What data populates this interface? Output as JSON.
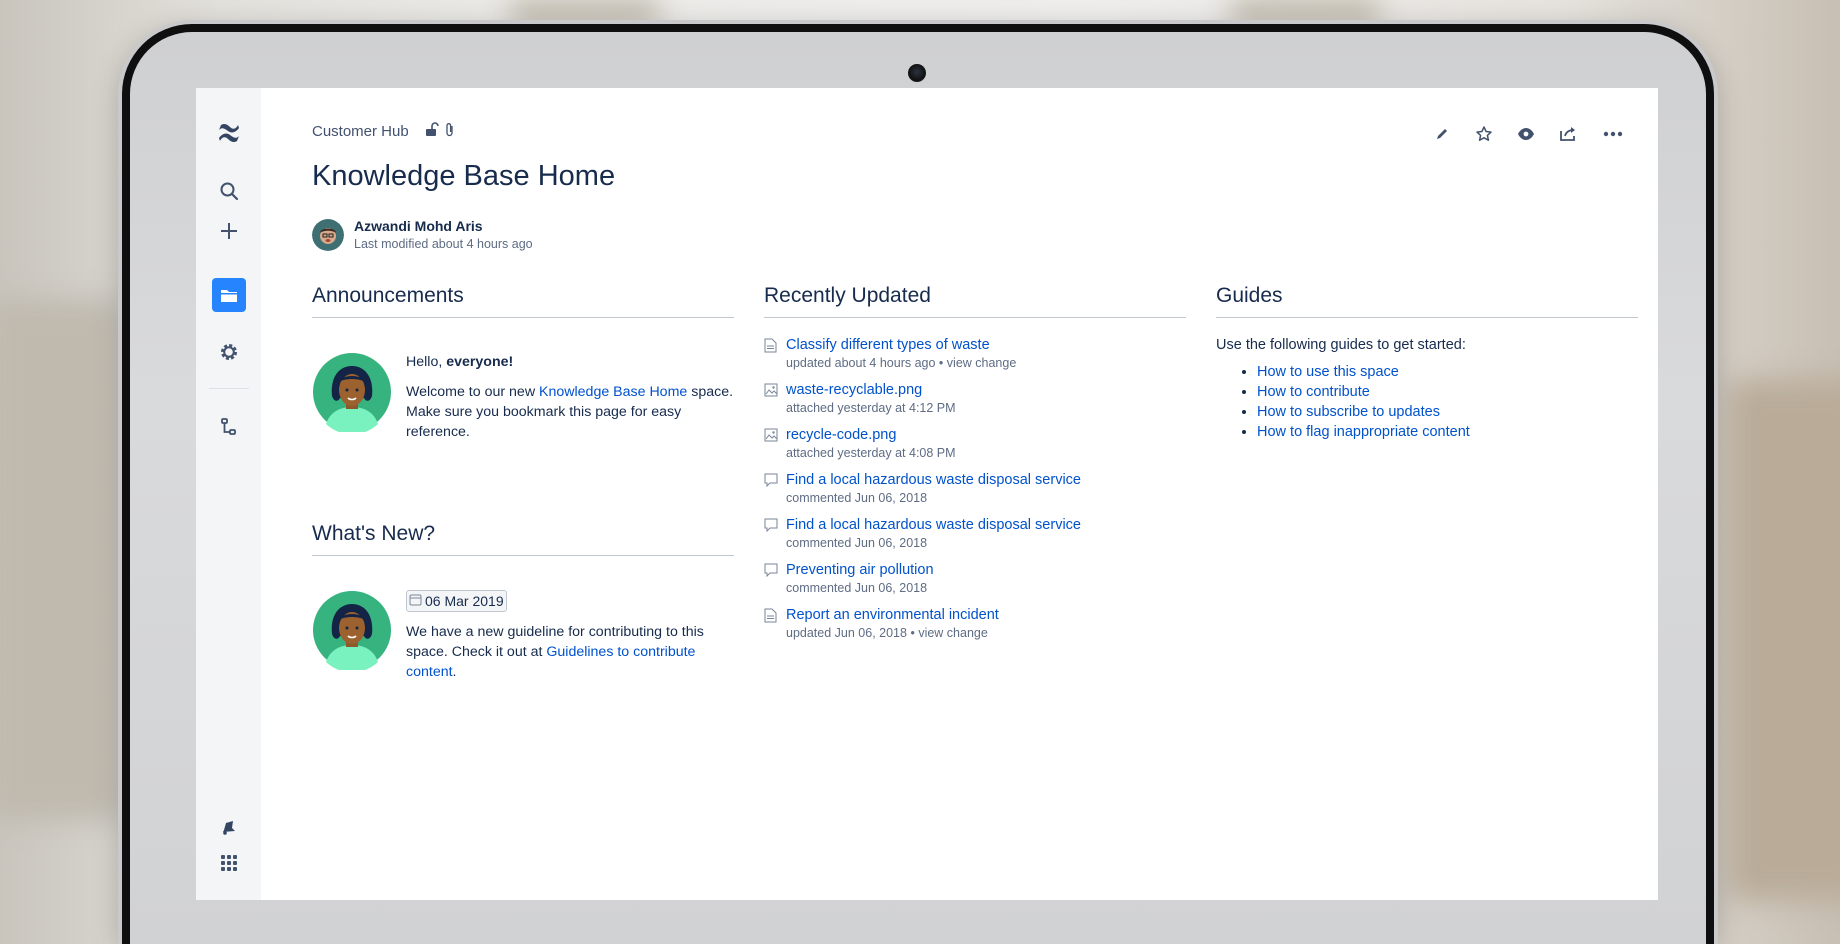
{
  "sidebar": {
    "items": [
      {
        "icon": "confluence-logo-icon"
      },
      {
        "icon": "search-icon"
      },
      {
        "icon": "plus-icon"
      },
      {
        "icon": "folder-icon"
      },
      {
        "icon": "gear-icon"
      },
      {
        "icon": "page-tree-icon"
      },
      {
        "icon": "notification-bell-icon"
      },
      {
        "icon": "app-switcher-icon"
      }
    ],
    "accent": "#2684ff"
  },
  "breadcrumb": {
    "space": "Customer Hub"
  },
  "page": {
    "title": "Knowledge Base Home",
    "author": "Azwandi Mohd Aris",
    "last_modified": "Last modified about 4 hours ago"
  },
  "actions": [
    "edit-icon",
    "star-icon",
    "watch-icon",
    "share-icon",
    "more-icon"
  ],
  "announcements": {
    "heading": "Announcements",
    "hello_prefix": "Hello, ",
    "hello_bold": "everyone!",
    "welcome_prefix": "Welcome to our new ",
    "welcome_link": "Knowledge Base Home",
    "welcome_suffix": " space. Make sure you bookmark this page for easy reference."
  },
  "whats_new": {
    "heading": "What's New?",
    "date": "06 Mar 2019",
    "text_prefix": "We have a new guideline for contributing to this space. Check it out at ",
    "link": "Guidelines to contribute content",
    "text_suffix": "."
  },
  "recently_updated": {
    "heading": "Recently Updated",
    "items": [
      {
        "type": "page",
        "title": "Classify different types of waste",
        "meta": "updated about 4 hours ago",
        "extra": "view change"
      },
      {
        "type": "image",
        "title": "waste-recyclable.png",
        "meta": "attached yesterday at 4:12 PM",
        "extra": ""
      },
      {
        "type": "image",
        "title": "recycle-code.png",
        "meta": "attached yesterday at 4:08 PM",
        "extra": ""
      },
      {
        "type": "comment",
        "title": "Find a local hazardous waste disposal service",
        "meta": "commented Jun 06, 2018",
        "extra": ""
      },
      {
        "type": "comment",
        "title": "Find a local hazardous waste disposal service",
        "meta": "commented Jun 06, 2018",
        "extra": ""
      },
      {
        "type": "comment",
        "title": "Preventing air pollution",
        "meta": "commented Jun 06, 2018",
        "extra": ""
      },
      {
        "type": "page",
        "title": "Report an environmental incident",
        "meta": "updated Jun 06, 2018",
        "extra": "view change"
      }
    ]
  },
  "guides": {
    "heading": "Guides",
    "intro": "Use the following guides to get started:",
    "links": [
      "How to use this space",
      "How to contribute",
      "How to subscribe to updates",
      "How to flag inappropriate content"
    ]
  },
  "colors": {
    "link": "#0052cc",
    "text": "#172b4d",
    "muted": "#5e6c84"
  }
}
